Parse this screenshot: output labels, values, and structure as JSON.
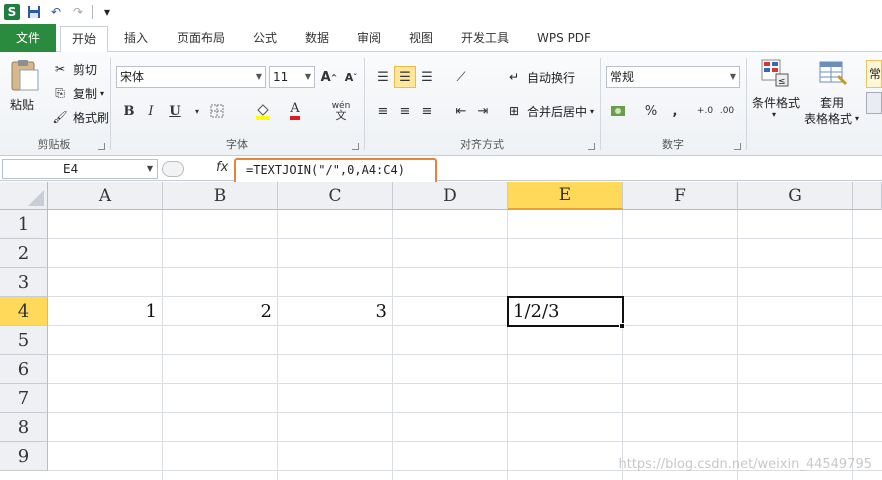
{
  "quick_access": {
    "logo_letter": "S",
    "customize_glyph": "▾"
  },
  "tabs": [
    "文件",
    "开始",
    "插入",
    "页面布局",
    "公式",
    "数据",
    "审阅",
    "视图",
    "开发工具",
    "WPS PDF"
  ],
  "ribbon": {
    "clipboard": {
      "paste": "粘贴",
      "cut": "剪切",
      "copy": "复制",
      "format_painter": "格式刷",
      "label": "剪贴板"
    },
    "font": {
      "name": "宋体",
      "size": "11",
      "grow": "A",
      "shrink": "A",
      "bold": "B",
      "italic": "I",
      "underline": "U",
      "font_color_letter": "A",
      "phonetic": "wén",
      "label": "字体"
    },
    "alignment": {
      "wrap": "自动换行",
      "merge": "合并后居中",
      "label": "对齐方式"
    },
    "number": {
      "format": "常规",
      "percent": "%",
      "comma": ",",
      "label": "数字"
    },
    "styles": {
      "conditional": "条件格式",
      "table_line1": "套用",
      "table_line2": "表格格式",
      "cell_style": "常"
    }
  },
  "formula_bar": {
    "name_box": "E4",
    "fx": "fx",
    "formula": "=TEXTJOIN(\"/\",0,A4:C4)"
  },
  "sheet": {
    "columns": [
      "A",
      "B",
      "C",
      "D",
      "E",
      "F",
      "G"
    ],
    "rows": [
      "1",
      "2",
      "3",
      "4",
      "5",
      "6",
      "7",
      "8",
      "9"
    ],
    "selected_column": "E",
    "selected_row": "4",
    "cells": {
      "A4": "1",
      "B4": "2",
      "C4": "3",
      "E4": "1/2/3"
    }
  },
  "watermark": "https://blog.csdn.net/weixin_44549795",
  "colors": {
    "file_tab": "#2a8a3e",
    "highlight": "#ffd95a",
    "formula_outline": "#e8843a"
  }
}
